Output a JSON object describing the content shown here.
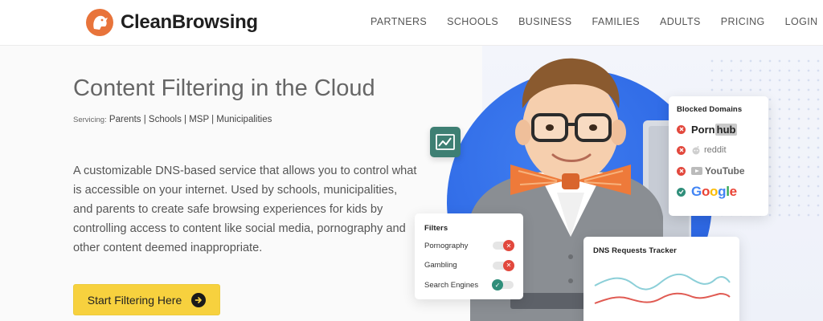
{
  "brand": {
    "name": "CleanBrowsing",
    "logo_color": "#e8743b"
  },
  "nav": {
    "items": [
      {
        "label": "PARTNERS"
      },
      {
        "label": "SCHOOLS"
      },
      {
        "label": "BUSINESS"
      },
      {
        "label": "FAMILIES"
      },
      {
        "label": "ADULTS"
      },
      {
        "label": "PRICING"
      },
      {
        "label": "LOGIN"
      }
    ]
  },
  "hero": {
    "title": "Content Filtering in the Cloud",
    "servicing_prefix": "Servicing:",
    "servicing_list": "Parents | Schools | MSP | Municipalities",
    "description": "A customizable DNS-based service that allows you to control what is accessible on your internet. Used by schools, municipalities, and parents to create safe browsing experiences for kids by controlling access to content like social media, pornography and other content deemed inappropriate.",
    "cta_label": "Start Filtering Here",
    "cta_icon": "arrow-right-circle-icon",
    "cta_color": "#f7d13e"
  },
  "blocked_domains": {
    "title": "Blocked Domains",
    "items": [
      {
        "name_part1": "Porn",
        "name_part2": "hub",
        "status": "blocked"
      },
      {
        "name": "reddit",
        "status": "blocked"
      },
      {
        "name": "YouTube",
        "status": "blocked"
      },
      {
        "name": "Google",
        "status": "allowed"
      }
    ]
  },
  "filters": {
    "title": "Filters",
    "items": [
      {
        "label": "Pornography",
        "state": "off"
      },
      {
        "label": "Gambling",
        "state": "off"
      },
      {
        "label": "Search Engines",
        "state": "on"
      }
    ]
  },
  "dns_tracker": {
    "title": "DNS Requests Tracker",
    "series_colors": {
      "top": "#8ccfd8",
      "bottom": "#e05b53"
    }
  },
  "colors": {
    "accent_blue": "#2f6ae6",
    "blocked_red": "#e2483d",
    "allowed_green": "#2f8e7a",
    "badge_green": "#3e7f73"
  }
}
